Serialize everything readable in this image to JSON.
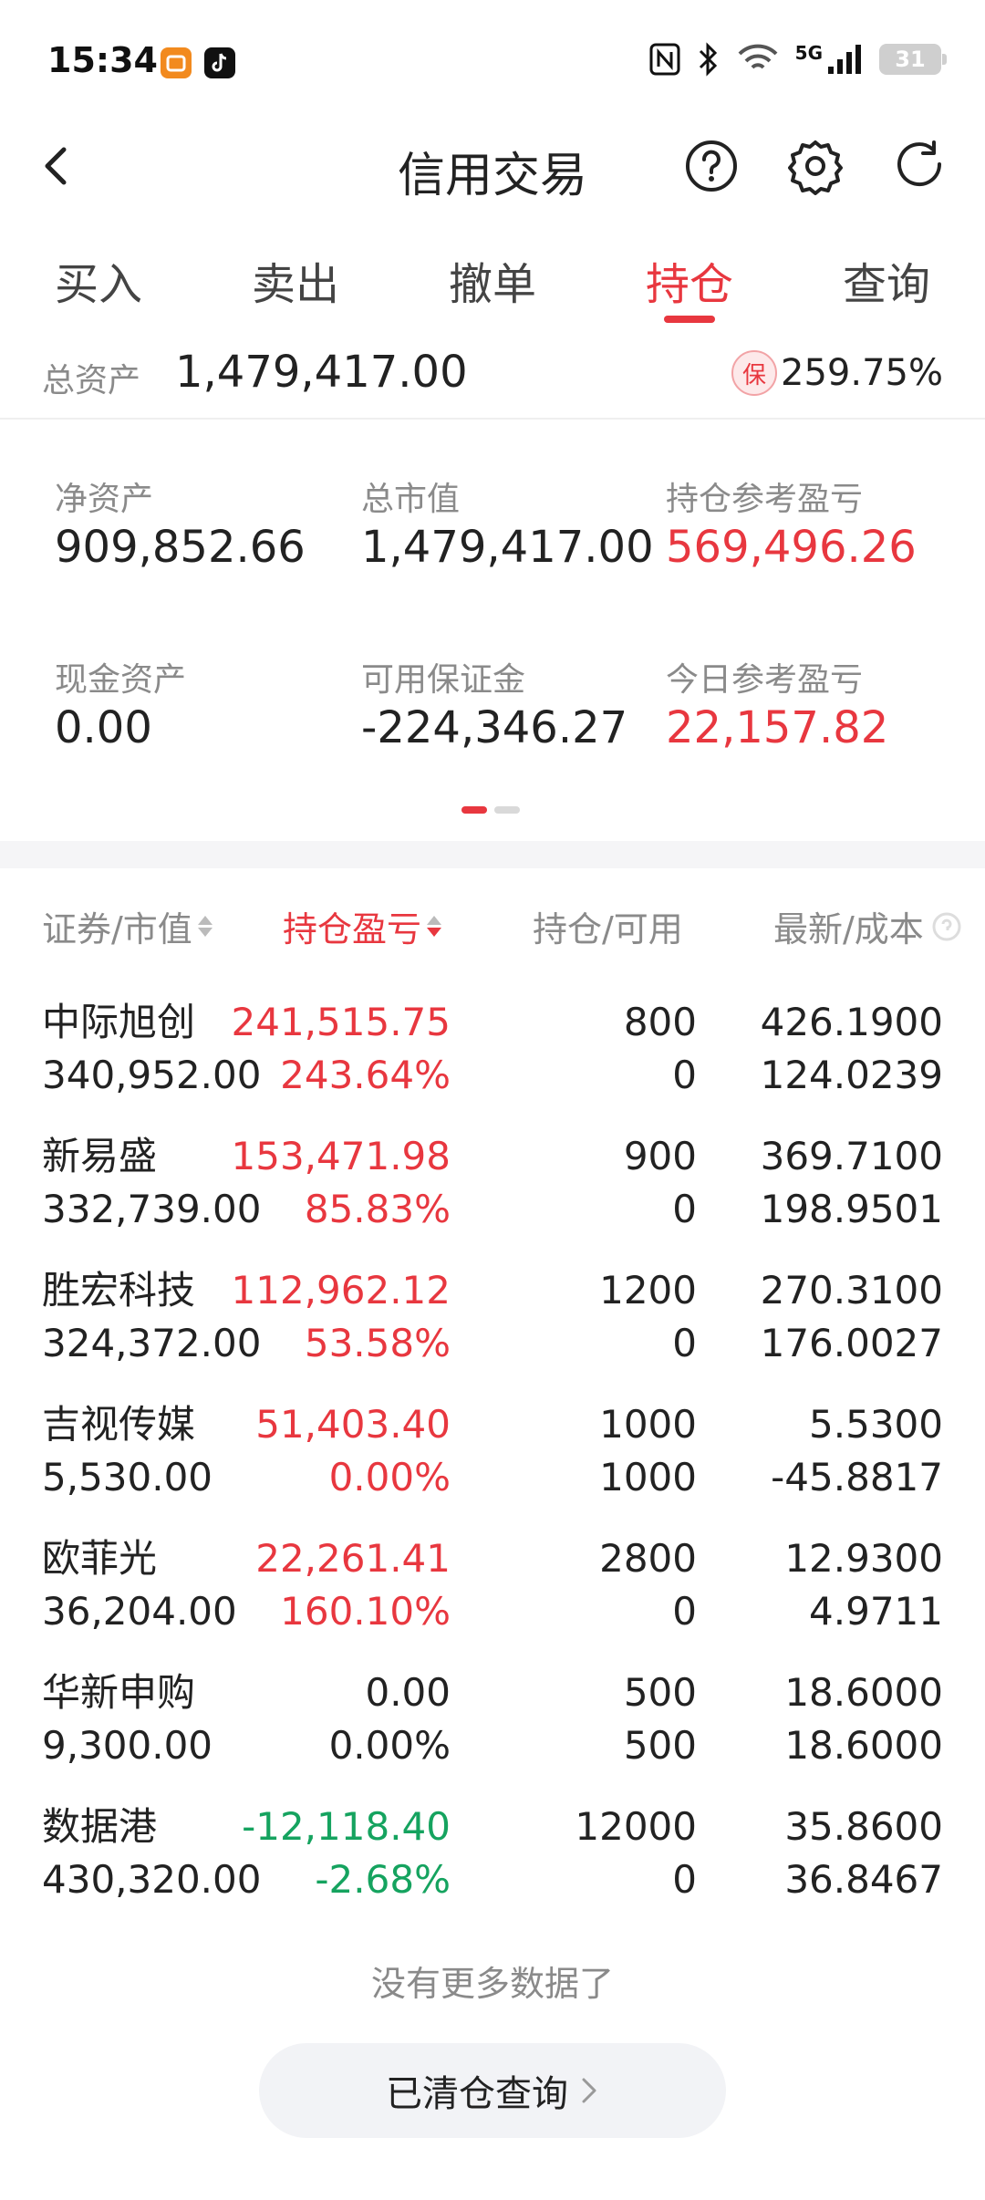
{
  "status": {
    "time": "15:34",
    "battery": "31",
    "network": "5G"
  },
  "nav": {
    "title": "信用交易"
  },
  "tabs": [
    "买入",
    "卖出",
    "撤单",
    "持仓",
    "查询"
  ],
  "active_tab": "持仓",
  "total_assets": {
    "label": "总资产",
    "value": "1,479,417.00",
    "badge": "保",
    "ratio": "259.75%"
  },
  "summary": [
    {
      "label": "净资产",
      "value": "909,852.66",
      "color": "default"
    },
    {
      "label": "总市值",
      "value": "1,479,417.00",
      "color": "default"
    },
    {
      "label": "持仓参考盈亏",
      "value": "569,496.26",
      "color": "red"
    },
    {
      "label": "现金资产",
      "value": "0.00",
      "color": "default"
    },
    {
      "label": "可用保证金",
      "value": "-224,346.27",
      "color": "default"
    },
    {
      "label": "今日参考盈亏",
      "value": "22,157.82",
      "color": "red"
    }
  ],
  "headers": [
    "证券/市值",
    "持仓盈亏",
    "持仓/可用",
    "最新/成本"
  ],
  "positions": [
    {
      "name": "中际旭创",
      "market_value": "340,952.00",
      "pnl": "241,515.75",
      "pnl_pct": "243.64%",
      "hold": "800",
      "avail": "0",
      "last": "426.1900",
      "cost": "124.0239",
      "tone": "red"
    },
    {
      "name": "新易盛",
      "market_value": "332,739.00",
      "pnl": "153,471.98",
      "pnl_pct": "85.83%",
      "hold": "900",
      "avail": "0",
      "last": "369.7100",
      "cost": "198.9501",
      "tone": "red"
    },
    {
      "name": "胜宏科技",
      "market_value": "324,372.00",
      "pnl": "112,962.12",
      "pnl_pct": "53.58%",
      "hold": "1200",
      "avail": "0",
      "last": "270.3100",
      "cost": "176.0027",
      "tone": "red"
    },
    {
      "name": "吉视传媒",
      "market_value": "5,530.00",
      "pnl": "51,403.40",
      "pnl_pct": "0.00%",
      "hold": "1000",
      "avail": "1000",
      "last": "5.5300",
      "cost": "-45.8817",
      "tone": "red"
    },
    {
      "name": "欧菲光",
      "market_value": "36,204.00",
      "pnl": "22,261.41",
      "pnl_pct": "160.10%",
      "hold": "2800",
      "avail": "0",
      "last": "12.9300",
      "cost": "4.9711",
      "tone": "red"
    },
    {
      "name": "华新申购",
      "market_value": "9,300.00",
      "pnl": "0.00",
      "pnl_pct": "0.00%",
      "hold": "500",
      "avail": "500",
      "last": "18.6000",
      "cost": "18.6000",
      "tone": "default"
    },
    {
      "name": "数据港",
      "market_value": "430,320.00",
      "pnl": "-12,118.40",
      "pnl_pct": "-2.68%",
      "hold": "12000",
      "avail": "0",
      "last": "35.8600",
      "cost": "36.8467",
      "tone": "green"
    }
  ],
  "footer": {
    "no_more": "没有更多数据了",
    "cleared_button": "已清仓查询"
  },
  "colors": {
    "red": "#e8373f",
    "green": "#15a35f",
    "gray": "#8a8a8a"
  }
}
